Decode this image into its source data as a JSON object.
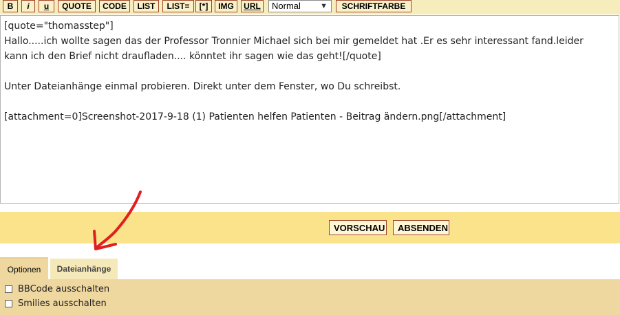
{
  "toolbar": {
    "buttons": [
      {
        "id": "bold",
        "label": "B"
      },
      {
        "id": "italic",
        "label": "i"
      },
      {
        "id": "underline",
        "label": "u"
      },
      {
        "id": "quote",
        "label": "QUOTE"
      },
      {
        "id": "code",
        "label": "CODE"
      },
      {
        "id": "list",
        "label": "LIST"
      },
      {
        "id": "list-ordered",
        "label": "LIST="
      },
      {
        "id": "list-item",
        "label": "[*]"
      },
      {
        "id": "img",
        "label": "IMG"
      },
      {
        "id": "url",
        "label": "URL"
      },
      {
        "id": "font-color",
        "label": "SCHRIFTFARBE"
      }
    ],
    "size_select_value": "Normal"
  },
  "editor": {
    "lines": [
      "[quote=\"thomasstep\"]",
      "Hallo.....ich wollte sagen das der Professor Tronnier Michael sich bei mir gemeldet hat .Er es sehr interessant fand.leider",
      "kann ich den Brief nicht draufladen.... könntet ihr sagen wie das geht![/quote]",
      "",
      "Unter Dateianhänge einmal probieren. Direkt unter dem Fenster, wo Du schreibst.",
      "",
      "[attachment=0]Screenshot-2017-9-18 (1) Patienten helfen Patienten - Beitrag ändern.png[/attachment]"
    ]
  },
  "submit": {
    "preview_label": "VORSCHAU",
    "send_label": "ABSENDEN"
  },
  "tabs": {
    "options_label": "Optionen",
    "attachments_label": "Dateianhänge"
  },
  "options": {
    "items": [
      {
        "label": "BBCode ausschalten",
        "checked": false
      },
      {
        "label": "Smilies ausschalten",
        "checked": false
      }
    ]
  },
  "colors": {
    "toolbar_bg": "#f7ecbb",
    "button_border": "#a0442a",
    "submit_bar_bg": "#fae38a",
    "options_bg": "#efd7a0",
    "annotation_arrow": "#e02020"
  },
  "annotation": {
    "icon": "red-arrow-icon"
  }
}
